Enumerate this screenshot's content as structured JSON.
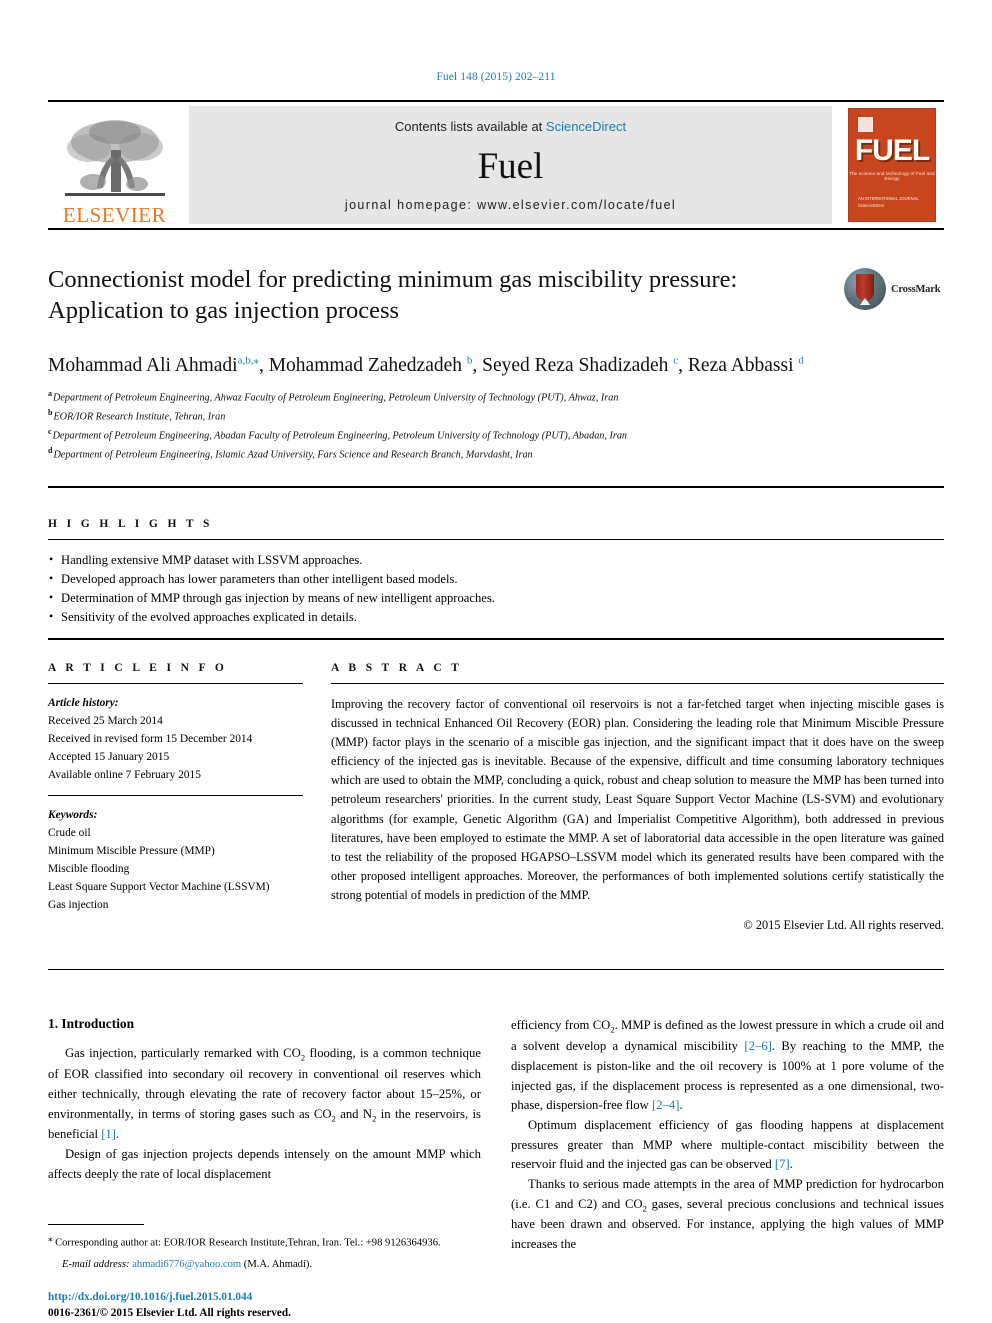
{
  "running_head": "Fuel 148 (2015) 202–211",
  "masthead": {
    "publisher_name": "ELSEVIER",
    "contents_prefix": "Contents lists available at ",
    "contents_link": "ScienceDirect",
    "journal_name": "Fuel",
    "homepage_label": "journal homepage: www.elsevier.com/locate/fuel",
    "cover": {
      "title": "FUEL",
      "subtitle": "The science and technology of Fuel and Energy",
      "footer": "AN INTERNATIONAL JOURNAL\nScienceDirect"
    }
  },
  "article": {
    "title": "Connectionist model for predicting minimum gas miscibility pressure: Application to gas injection process",
    "crossmark_label": "CrossMark",
    "authors": [
      {
        "name": "Mohammad Ali Ahmadi",
        "sup": "a,b,⁎"
      },
      {
        "name": "Mohammad Zahedzadeh",
        "sup": "b"
      },
      {
        "name": "Seyed Reza Shadizadeh",
        "sup": "c"
      },
      {
        "name": "Reza Abbassi",
        "sup": "d"
      }
    ],
    "affiliations": [
      {
        "mark": "a",
        "text": "Department of Petroleum Engineering, Ahwaz Faculty of Petroleum Engineering, Petroleum University of Technology (PUT), Ahwaz, Iran"
      },
      {
        "mark": "b",
        "text": "EOR/IOR Research Institute, Tehran, Iran"
      },
      {
        "mark": "c",
        "text": "Department of Petroleum Engineering, Abadan Faculty of Petroleum Engineering, Petroleum University of Technology (PUT), Abadan, Iran"
      },
      {
        "mark": "d",
        "text": "Department of Petroleum Engineering, Islamic Azad University, Fars Science and Research Branch, Marvdasht, Iran"
      }
    ]
  },
  "highlights": {
    "heading": "H I G H L I G H T S",
    "items": [
      "Handling extensive MMP dataset with LSSVM approaches.",
      "Developed approach has lower parameters than other intelligent based models.",
      "Determination of MMP through gas injection by means of new intelligent approaches.",
      "Sensitivity of the evolved approaches explicated in details."
    ]
  },
  "article_info": {
    "heading": "A R T I C L E    I N F O",
    "history_label": "Article history:",
    "history": [
      "Received 25 March 2014",
      "Received in revised form 15 December 2014",
      "Accepted 15 January 2015",
      "Available online 7 February 2015"
    ],
    "keywords_label": "Keywords:",
    "keywords": [
      "Crude oil",
      "Minimum Miscible Pressure (MMP)",
      "Miscible flooding",
      "Least Square Support Vector Machine (LSSVM)",
      "Gas injection"
    ]
  },
  "abstract": {
    "heading": "A B S T R A C T",
    "text": "Improving the recovery factor of conventional oil reservoirs is not a far-fetched target when injecting miscible gases is discussed in technical Enhanced Oil Recovery (EOR) plan. Considering the leading role that Minimum Miscible Pressure (MMP) factor plays in the scenario of a miscible gas injection, and the significant impact that it does have on the sweep efficiency of the injected gas is inevitable. Because of the expensive, difficult and time consuming laboratory techniques which are used to obtain the MMP, concluding a quick, robust and cheap solution to measure the MMP has been turned into petroleum researchers' priorities. In the current study, Least Square Support Vector Machine (LS-SVM) and evolutionary algorithms (for example, Genetic Algorithm (GA) and Imperialist Competitive Algorithm), both addressed in previous literatures, have been employed to estimate the MMP. A set of laboratorial data accessible in the open literature was gained to test the reliability of the proposed HGAPSO–LSSVM model which its generated results have been compared with the other proposed intelligent approaches. Moreover, the performances of both implemented solutions certify statistically the strong potential of models in prediction of the MMP.",
    "copyright": "© 2015 Elsevier Ltd. All rights reserved."
  },
  "body": {
    "section_heading": "1. Introduction",
    "left_paragraphs": [
      "Gas injection, particularly remarked with CO2 flooding, is a common technique of EOR classified into secondary oil recovery in conventional oil reserves which either technically, through elevating the rate of recovery factor about 15–25%, or environmentally, in terms of storing gases such as CO2 and N2 in the reservoirs, is beneficial [1].",
      "Design of gas injection projects depends intensely on the amount MMP which affects deeply the rate of local displacement"
    ],
    "right_paragraphs": [
      "efficiency from CO2. MMP is defined as the lowest pressure in which a crude oil and a solvent develop a dynamical miscibility [2–6]. By reaching to the MMP, the displacement is piston-like and the oil recovery is 100% at 1 pore volume of the injected gas, if the displacement process is represented as a one dimensional, two-phase, dispersion-free flow [2–4].",
      "Optimum displacement efficiency of gas flooding happens at displacement pressures greater than MMP where multiple-contact miscibility between the reservoir fluid and the injected gas can be observed [7].",
      "Thanks to serious made attempts in the area of MMP prediction for hydrocarbon (i.e. C1 and C2) and CO2 gases, several precious conclusions and technical issues have been drawn and observed. For instance, applying the high values of MMP increases the"
    ]
  },
  "footnotes": {
    "corresponding": "⁎ Corresponding author at: EOR/IOR Research Institute,Tehran, Iran. Tel.: +98 9126364936.",
    "email_label": "E-mail address:",
    "email": "ahmadi6776@yahoo.com",
    "email_owner": "(M.A. Ahmadi).",
    "doi": "http://dx.doi.org/10.1016/j.fuel.2015.01.044",
    "issn_line": "0016-2361/© 2015 Elsevier Ltd. All rights reserved."
  },
  "colors": {
    "link": "#1a7bb9",
    "elsevier_orange": "#E87722",
    "cover_orange": "#c8461e"
  }
}
